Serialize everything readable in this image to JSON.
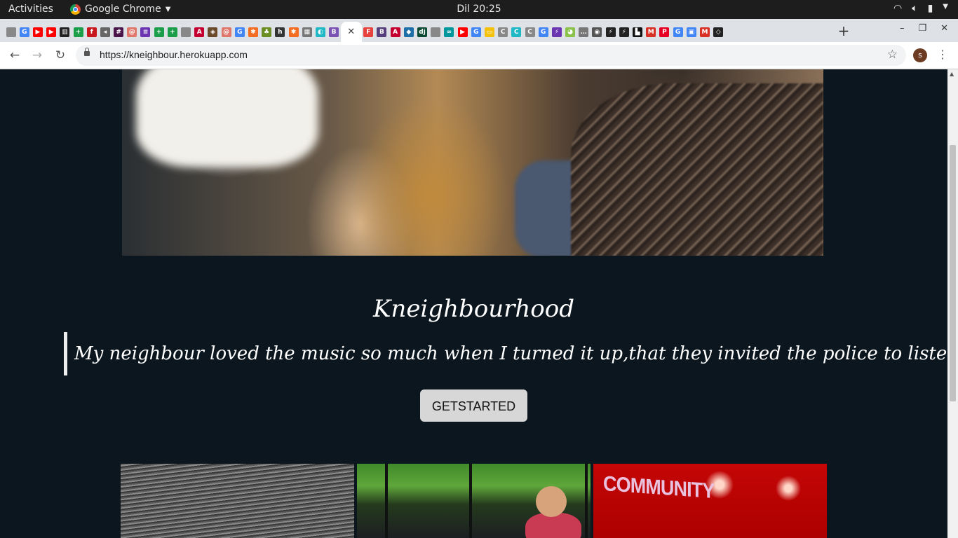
{
  "desktop": {
    "activities": "Activities",
    "app_name": "Google Chrome",
    "clock": "Dil 20:25",
    "tray_icons": [
      "wifi-icon",
      "volume-icon",
      "battery-icon",
      "chevron-down-icon"
    ]
  },
  "browser": {
    "tabs": [
      {
        "icon": "page",
        "color": "#888",
        "glyph": ""
      },
      {
        "icon": "google",
        "color": "#4285f4",
        "glyph": "G"
      },
      {
        "icon": "youtube",
        "color": "#ff0000",
        "glyph": "▶"
      },
      {
        "icon": "youtube",
        "color": "#ff0000",
        "glyph": "▶"
      },
      {
        "icon": "kinder",
        "color": "#222",
        "glyph": "▥"
      },
      {
        "icon": "plus-app",
        "color": "#1a9e4a",
        "glyph": "+"
      },
      {
        "icon": "f-app",
        "color": "#c8161d",
        "glyph": "f"
      },
      {
        "icon": "audio",
        "color": "#666",
        "glyph": "◂"
      },
      {
        "icon": "slack",
        "color": "#4a154b",
        "glyph": "#"
      },
      {
        "icon": "swirl",
        "color": "#e0776b",
        "glyph": "@"
      },
      {
        "icon": "list",
        "color": "#6b35b2",
        "glyph": "≡"
      },
      {
        "icon": "plus-app",
        "color": "#1a9e4a",
        "glyph": "+"
      },
      {
        "icon": "plus-app",
        "color": "#1a9e4a",
        "glyph": "+"
      },
      {
        "icon": "page",
        "color": "#888",
        "glyph": ""
      },
      {
        "icon": "angular",
        "color": "#c3002f",
        "glyph": "A"
      },
      {
        "icon": "brown",
        "color": "#6b4a2b",
        "glyph": "◈"
      },
      {
        "icon": "swirl",
        "color": "#e0776b",
        "glyph": "@"
      },
      {
        "icon": "google",
        "color": "#4285f4",
        "glyph": "G"
      },
      {
        "icon": "asterisk",
        "color": "#f36c21",
        "glyph": "✱"
      },
      {
        "icon": "tree",
        "color": "#6b8e23",
        "glyph": "♣"
      },
      {
        "icon": "h-app",
        "color": "#333",
        "glyph": "h"
      },
      {
        "icon": "asterisk",
        "color": "#f36c21",
        "glyph": "✱"
      },
      {
        "icon": "grid",
        "color": "#777",
        "glyph": "▦"
      },
      {
        "icon": "circle",
        "color": "#1fb8c4",
        "glyph": "◐"
      },
      {
        "icon": "bootstrap",
        "color": "#7952b3",
        "glyph": "B"
      },
      {
        "icon": "active",
        "color": "#fff",
        "glyph": "✕"
      },
      {
        "icon": "f-app",
        "color": "#e8423f",
        "glyph": "F"
      },
      {
        "icon": "bootstrap",
        "color": "#563d7c",
        "glyph": "B"
      },
      {
        "icon": "angular",
        "color": "#c3002f",
        "glyph": "A"
      },
      {
        "icon": "bird",
        "color": "#1e6fa8",
        "glyph": "◆"
      },
      {
        "icon": "django",
        "color": "#0c4b33",
        "glyph": "dj"
      },
      {
        "icon": "page",
        "color": "#888",
        "glyph": ""
      },
      {
        "icon": "arduino",
        "color": "#00979c",
        "glyph": "∞"
      },
      {
        "icon": "youtube",
        "color": "#ff0000",
        "glyph": "▶"
      },
      {
        "icon": "google",
        "color": "#4285f4",
        "glyph": "G"
      },
      {
        "icon": "yellow",
        "color": "#f4c20d",
        "glyph": "▭"
      },
      {
        "icon": "c-app",
        "color": "#888",
        "glyph": "C"
      },
      {
        "icon": "c-app",
        "color": "#1fb8c4",
        "glyph": "C"
      },
      {
        "icon": "c-app",
        "color": "#888",
        "glyph": "C"
      },
      {
        "icon": "google",
        "color": "#4285f4",
        "glyph": "G"
      },
      {
        "icon": "zigzag",
        "color": "#6b35b2",
        "glyph": "⚡"
      },
      {
        "icon": "lime",
        "color": "#8bc34a",
        "glyph": "◕"
      },
      {
        "icon": "dots",
        "color": "#777",
        "glyph": "…"
      },
      {
        "icon": "camera",
        "color": "#555",
        "glyph": "◉"
      },
      {
        "icon": "bolt",
        "color": "#222",
        "glyph": "⚡"
      },
      {
        "icon": "bolt",
        "color": "#222",
        "glyph": "⚡"
      },
      {
        "icon": "dark",
        "color": "#111",
        "glyph": "▙"
      },
      {
        "icon": "gmail",
        "color": "#d93025",
        "glyph": "M"
      },
      {
        "icon": "pinterest",
        "color": "#e60023",
        "glyph": "P"
      },
      {
        "icon": "google",
        "color": "#4285f4",
        "glyph": "G"
      },
      {
        "icon": "colorful",
        "color": "#4285f4",
        "glyph": "▣"
      },
      {
        "icon": "gmail",
        "color": "#d93025",
        "glyph": "M"
      },
      {
        "icon": "codepen",
        "color": "#222",
        "glyph": "◇"
      }
    ],
    "new_tab": "+",
    "window_controls": {
      "minimize": "–",
      "maximize": "❐",
      "close": "✕"
    },
    "nav": {
      "back": "←",
      "forward": "→",
      "reload": "↻"
    },
    "url": "https://kneighbour.herokuapp.com",
    "bookmark_icon": "☆",
    "profile_initial": "s",
    "menu": "⋮"
  },
  "page": {
    "title": "Kneighbourhood",
    "quote": "My neighbour loved the music so much when I turned it up,that they invited the police to listen to it",
    "cta_label": "GETSTARTED",
    "community_label": "COMMUNITY"
  }
}
